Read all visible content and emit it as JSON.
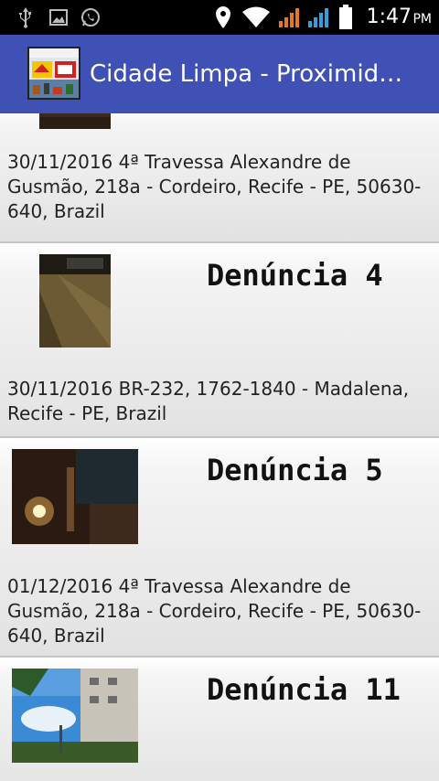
{
  "status_bar": {
    "time": "1:47",
    "ampm": "PM",
    "icons": [
      "usb-icon",
      "image-icon",
      "whatsapp-icon",
      "location-icon",
      "wifi-icon",
      "signal-icon",
      "signal-icon",
      "battery-icon"
    ]
  },
  "action_bar": {
    "title": "Cidade Limpa - Proximid…",
    "logo_text": "CIDADE LIMPA",
    "color": "#3f51b5"
  },
  "items": [
    {
      "title": "",
      "address": "30/11/2016 4ª Travessa Alexandre de Gusmão, 218a - Cordeiro, Recife - PE, 50630-640, Brazil"
    },
    {
      "title": "Denúncia 4",
      "address": "30/11/2016 BR-232, 1762-1840 - Madalena, Recife - PE, Brazil"
    },
    {
      "title": "Denúncia 5",
      "address": "01/12/2016 4ª Travessa Alexandre de Gusmão, 218a - Cordeiro, Recife - PE, 50630-640, Brazil"
    },
    {
      "title": "Denúncia 11",
      "address": ""
    }
  ]
}
